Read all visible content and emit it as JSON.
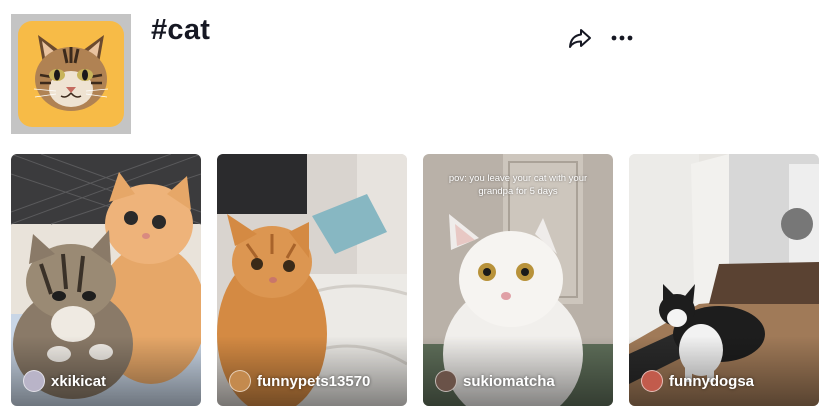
{
  "header": {
    "title": "#cat",
    "avatar_icon": "cat-face-icon",
    "share_icon": "share-arrow-icon",
    "more_icon": "more-dots-icon",
    "accent_background": "#f7bb47"
  },
  "videos": [
    {
      "author": "xkikicat",
      "caption": "",
      "theme": "#e8a25a"
    },
    {
      "author": "funnypets13570",
      "caption": "",
      "theme": "#d8893b"
    },
    {
      "author": "sukiomatcha",
      "caption": "pov: you leave your cat with your grandpa for 5 days",
      "theme": "#a8a29a"
    },
    {
      "author": "funnydogsa",
      "caption": "",
      "theme": "#8a6a52"
    }
  ]
}
